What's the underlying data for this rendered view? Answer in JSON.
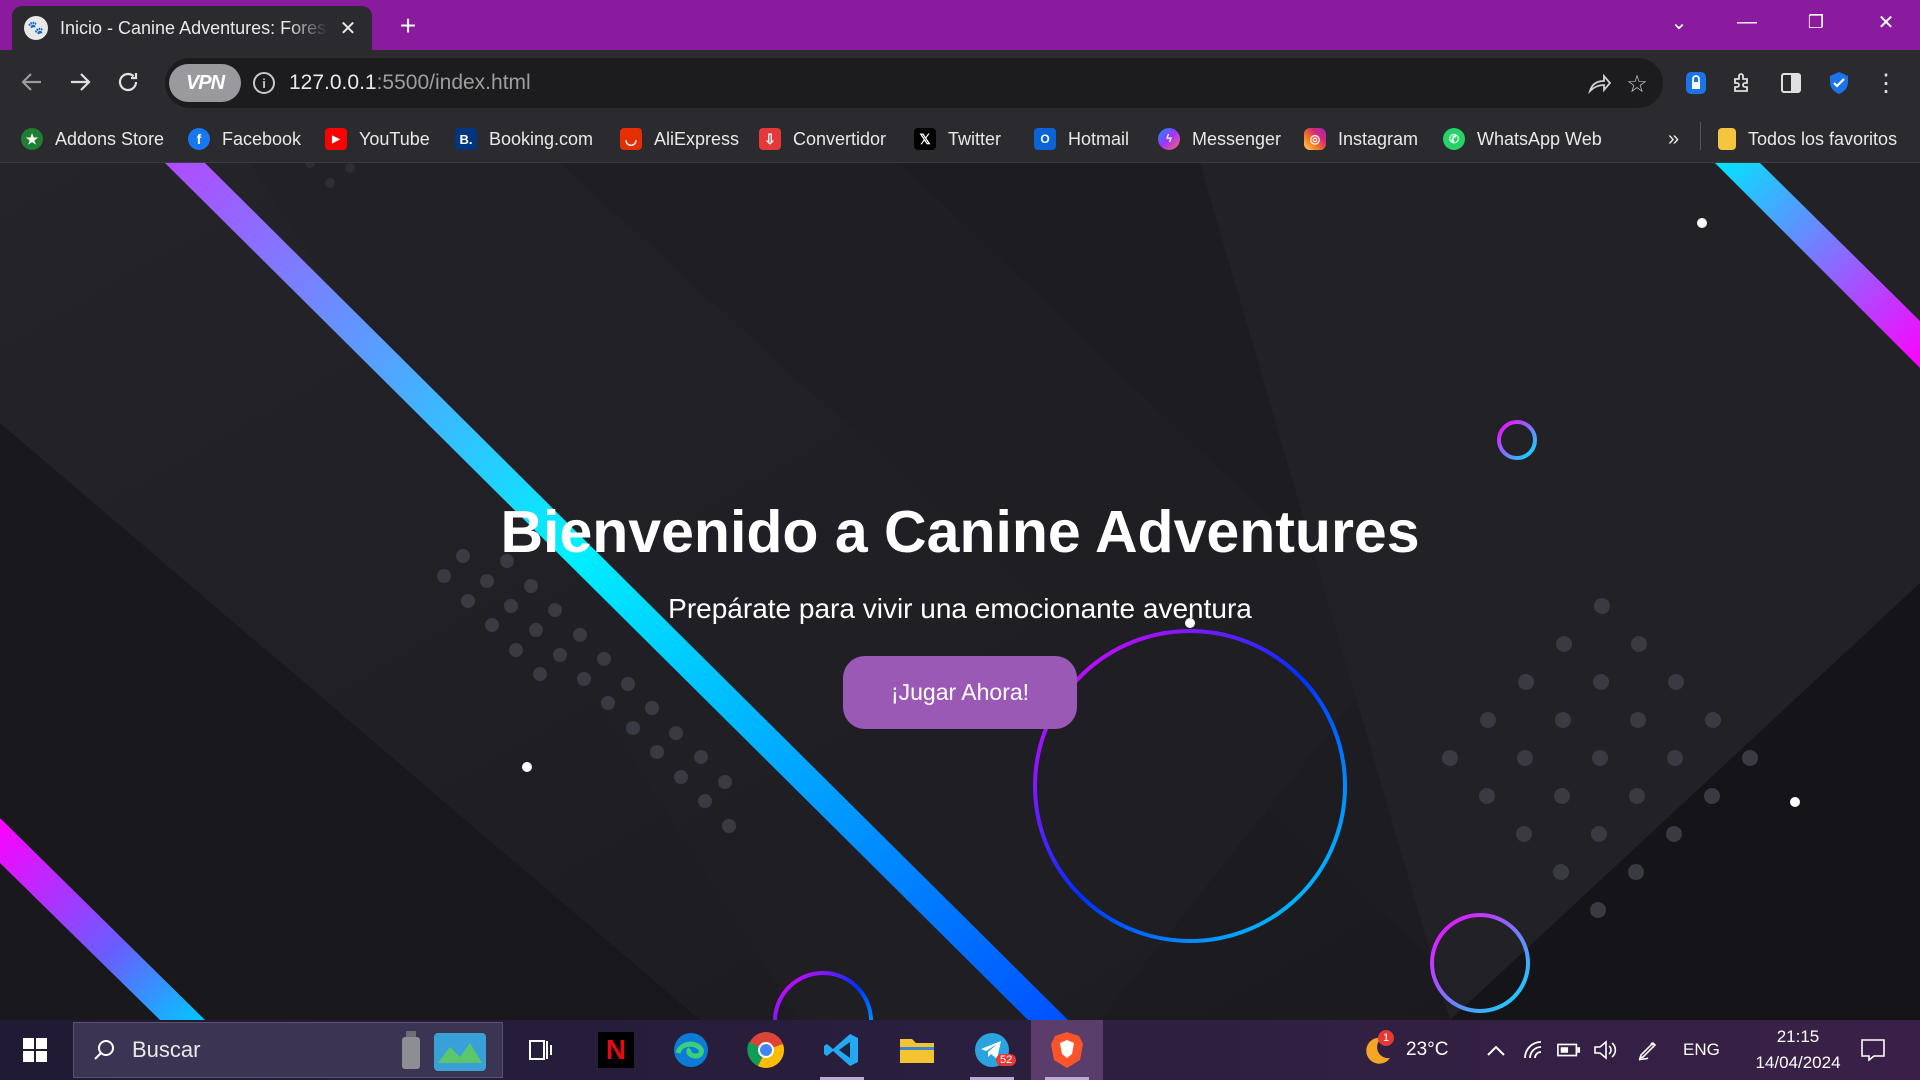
{
  "colors": {
    "titlebar": "#8a1a9e",
    "chrome": "#2b2b2f",
    "page_bg": "#1d1d22",
    "button": "#9b59b6",
    "accent_magenta": "#ff00ff",
    "accent_cyan": "#00e5ff",
    "accent_blue": "#0040ff"
  },
  "tab": {
    "title": "Inicio - Canine Adventures: Forest",
    "favicon": "paw-icon"
  },
  "window": {
    "minimize": "—",
    "restore": "❐",
    "close": "✕",
    "tab_search": "⌄"
  },
  "address_bar": {
    "vpn_label": "VPN",
    "url_host": "127.0.0.1",
    "url_rest": ":5500/index.html"
  },
  "bookmarks": {
    "items": [
      {
        "label": "Addons Store",
        "icon": "addons-store-icon"
      },
      {
        "label": "Facebook",
        "icon": "facebook-icon"
      },
      {
        "label": "YouTube",
        "icon": "youtube-icon"
      },
      {
        "label": "Booking.com",
        "icon": "booking-icon"
      },
      {
        "label": "AliExpress",
        "icon": "aliexpress-icon"
      },
      {
        "label": "Convertidor",
        "icon": "convertidor-icon"
      },
      {
        "label": "Twitter",
        "icon": "twitter-icon"
      },
      {
        "label": "Hotmail",
        "icon": "hotmail-icon"
      },
      {
        "label": "Messenger",
        "icon": "messenger-icon"
      },
      {
        "label": "Instagram",
        "icon": "instagram-icon"
      },
      {
        "label": "WhatsApp Web",
        "icon": "whatsapp-icon"
      }
    ],
    "overflow": "»",
    "all_bookmarks": "Todos los favoritos"
  },
  "page": {
    "title": "Bienvenido a Canine Adventures",
    "subtitle": "Prepárate para vivir una emocionante aventura",
    "play_button": "¡Jugar Ahora!"
  },
  "taskbar": {
    "search_placeholder": "Buscar",
    "apps": [
      "task-view",
      "netflix",
      "edge",
      "chrome",
      "vscode",
      "file-explorer",
      "telegram",
      "brave"
    ],
    "telegram_badge": "52",
    "weather_temp": "23°C",
    "weather_badge": "1",
    "language": "ENG",
    "time": "21:15",
    "date": "14/04/2024"
  }
}
